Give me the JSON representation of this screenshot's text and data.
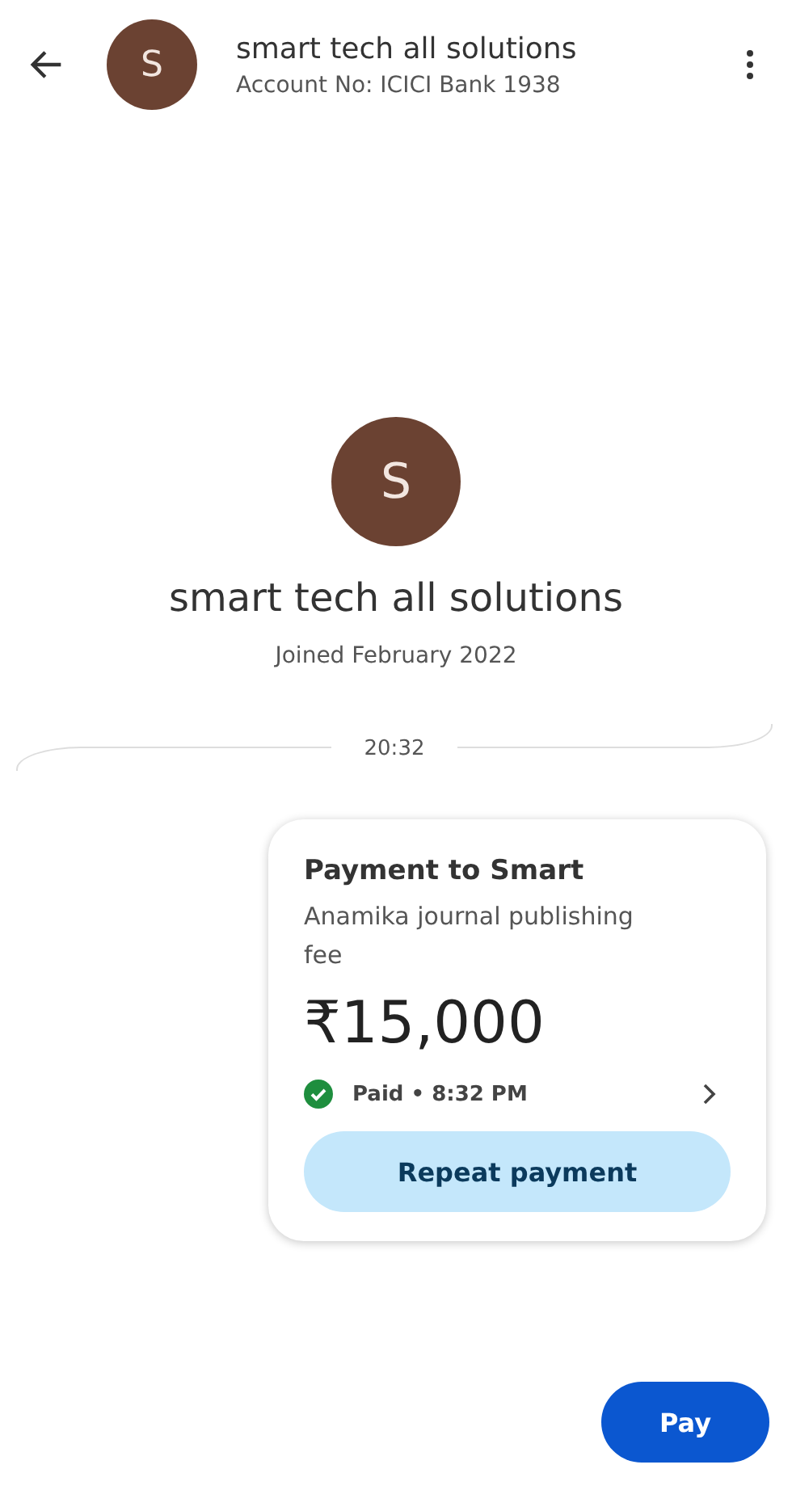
{
  "header": {
    "avatar_letter": "S",
    "title": "smart tech all solutions",
    "subtitle": "Account No: ICICI Bank 1938"
  },
  "profile": {
    "avatar_letter": "S",
    "name": "smart tech all solutions",
    "joined": "Joined February 2022"
  },
  "timestamp": "20:32",
  "payment_card": {
    "title": "Payment to Smart",
    "note": "Anamika journal publishing fee",
    "amount": "₹15,000",
    "status": "Paid • 8:32 PM",
    "action": "Repeat payment"
  },
  "pay_button": "Pay"
}
